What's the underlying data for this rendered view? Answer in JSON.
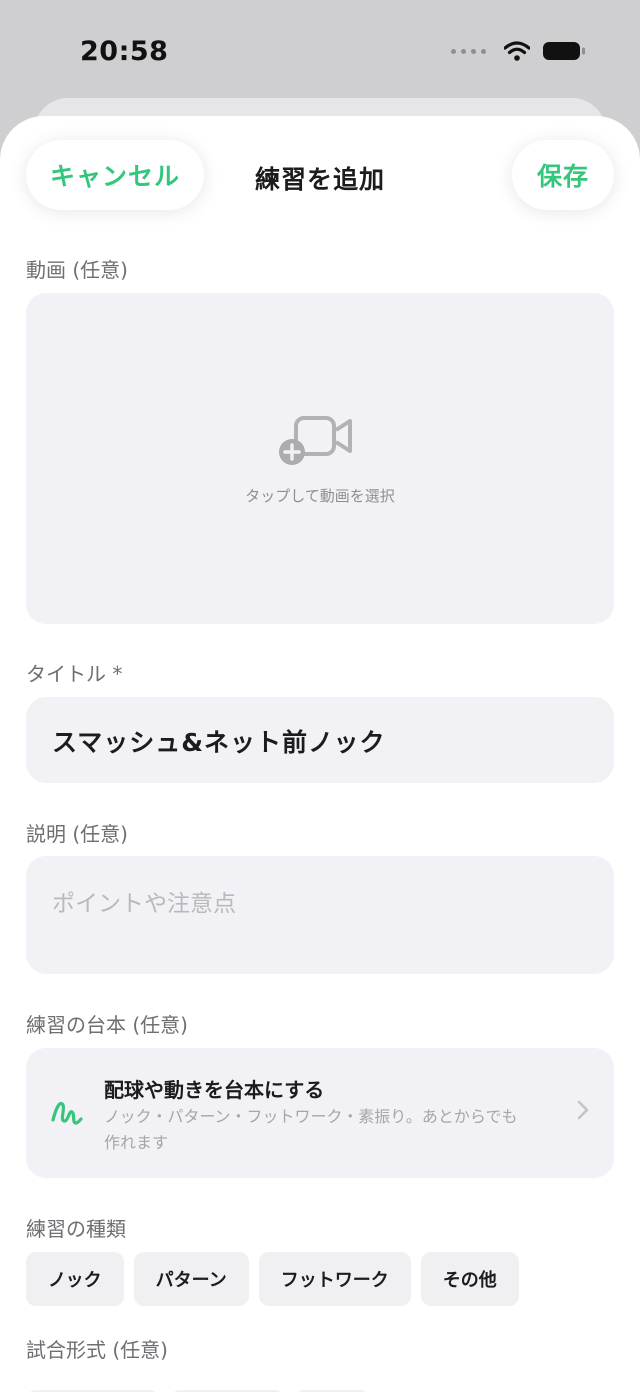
{
  "status_bar": {
    "time": "20:58"
  },
  "nav": {
    "cancel_label": "キャンセル",
    "title": "練習を追加",
    "save_label": "保存",
    "accent_color": "#34c77b"
  },
  "video": {
    "label": "動画 (任意)",
    "hint": "タップして動画を選択",
    "icon": "video-add-icon"
  },
  "title_field": {
    "label": "タイトル *",
    "value": "スマッシュ&ネット前ノック"
  },
  "description_field": {
    "label": "説明 (任意)",
    "placeholder": "ポイントや注意点"
  },
  "script": {
    "label": "練習の台本 (任意)",
    "title": "配球や動きを台本にする",
    "description": "ノック・パターン・フットワーク・素振り。あとからでも作れます",
    "icon": "scribble-icon"
  },
  "practice_type": {
    "label": "練習の種類",
    "options": [
      "ノック",
      "パターン",
      "フットワーク",
      "その他"
    ]
  },
  "match_format": {
    "label": "試合形式 (任意)"
  }
}
